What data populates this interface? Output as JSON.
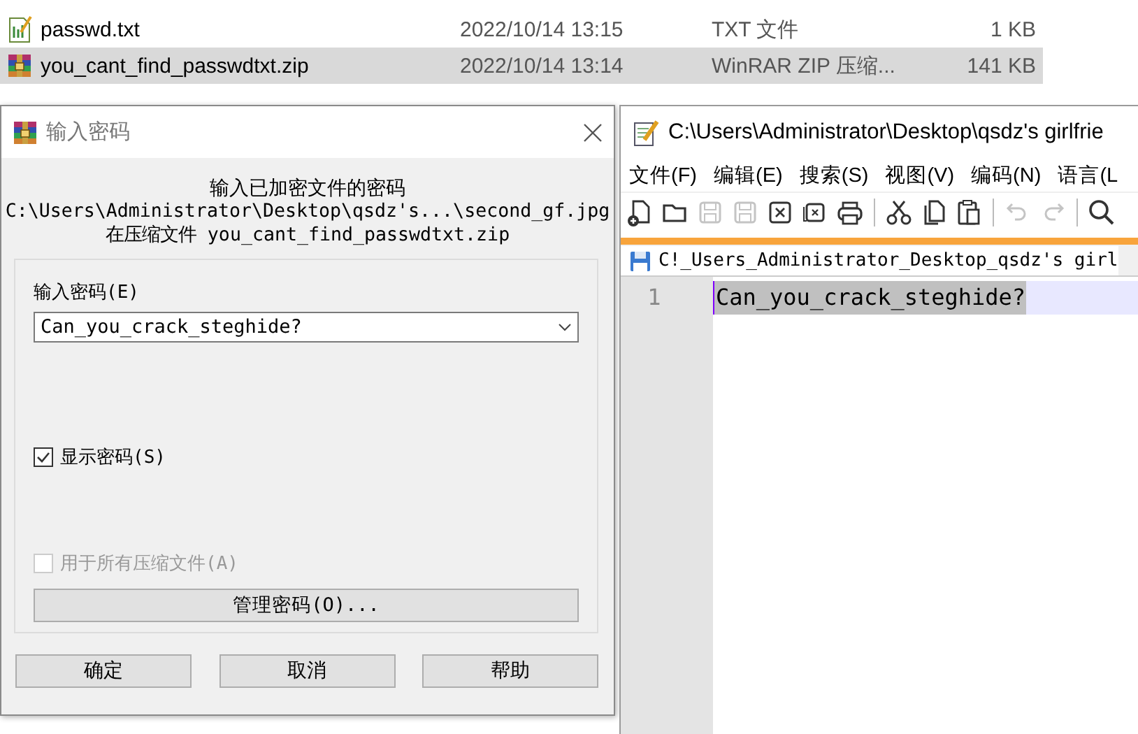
{
  "explorer": {
    "files": [
      {
        "kind": "text",
        "name": "passwd.txt",
        "modified": "2022/10/14 13:15",
        "type": "TXT 文件",
        "size": "1 KB",
        "selected": false
      },
      {
        "kind": "archive",
        "name": "you_cant_find_passwdtxt.zip",
        "modified": "2022/10/14 13:14",
        "type": "WinRAR ZIP 压缩...",
        "size": "141 KB",
        "selected": true
      }
    ]
  },
  "password_dialog": {
    "title": "输入密码",
    "heading": "输入已加密文件的密码",
    "file_path": "C:\\Users\\Administrator\\Desktop\\qsdz's...\\second_gf.jpg",
    "archive_line": "在压缩文件 you_cant_find_passwdtxt.zip",
    "password_label": "输入密码(E)",
    "password_value": "Can_you_crack_steghide?",
    "show_password": {
      "label": "显示密码(S)",
      "checked": true,
      "disabled": false
    },
    "use_for_all": {
      "label": "用于所有压缩文件(A)",
      "checked": false,
      "disabled": true
    },
    "manage_button": "管理密码(O)...",
    "buttons": [
      "确定",
      "取消",
      "帮助"
    ]
  },
  "editor_window": {
    "title": "C:\\Users\\Administrator\\Desktop\\qsdz's girlfrie",
    "menu": [
      "文件(F)",
      "编辑(E)",
      "搜索(S)",
      "视图(V)",
      "编码(N)",
      "语言(L"
    ],
    "toolbar": [
      {
        "kind": "new",
        "disabled": false
      },
      {
        "kind": "open",
        "disabled": false
      },
      {
        "kind": "save",
        "disabled": true
      },
      {
        "kind": "save-all",
        "disabled": true
      },
      {
        "kind": "close",
        "disabled": false
      },
      {
        "kind": "close-all",
        "disabled": false
      },
      {
        "kind": "print",
        "disabled": false
      },
      {
        "kind": "separator"
      },
      {
        "kind": "cut",
        "disabled": false
      },
      {
        "kind": "copy",
        "disabled": false
      },
      {
        "kind": "paste",
        "disabled": false
      },
      {
        "kind": "separator"
      },
      {
        "kind": "undo",
        "disabled": true
      },
      {
        "kind": "redo",
        "disabled": true
      },
      {
        "kind": "separator"
      },
      {
        "kind": "search",
        "disabled": false
      }
    ],
    "tab": {
      "label": "C!_Users_Administrator_Desktop_qsdz's girl",
      "selected": true
    },
    "lines": [
      {
        "number": "1",
        "text": "Can_you_crack_steghide?",
        "selected": true
      }
    ]
  }
}
